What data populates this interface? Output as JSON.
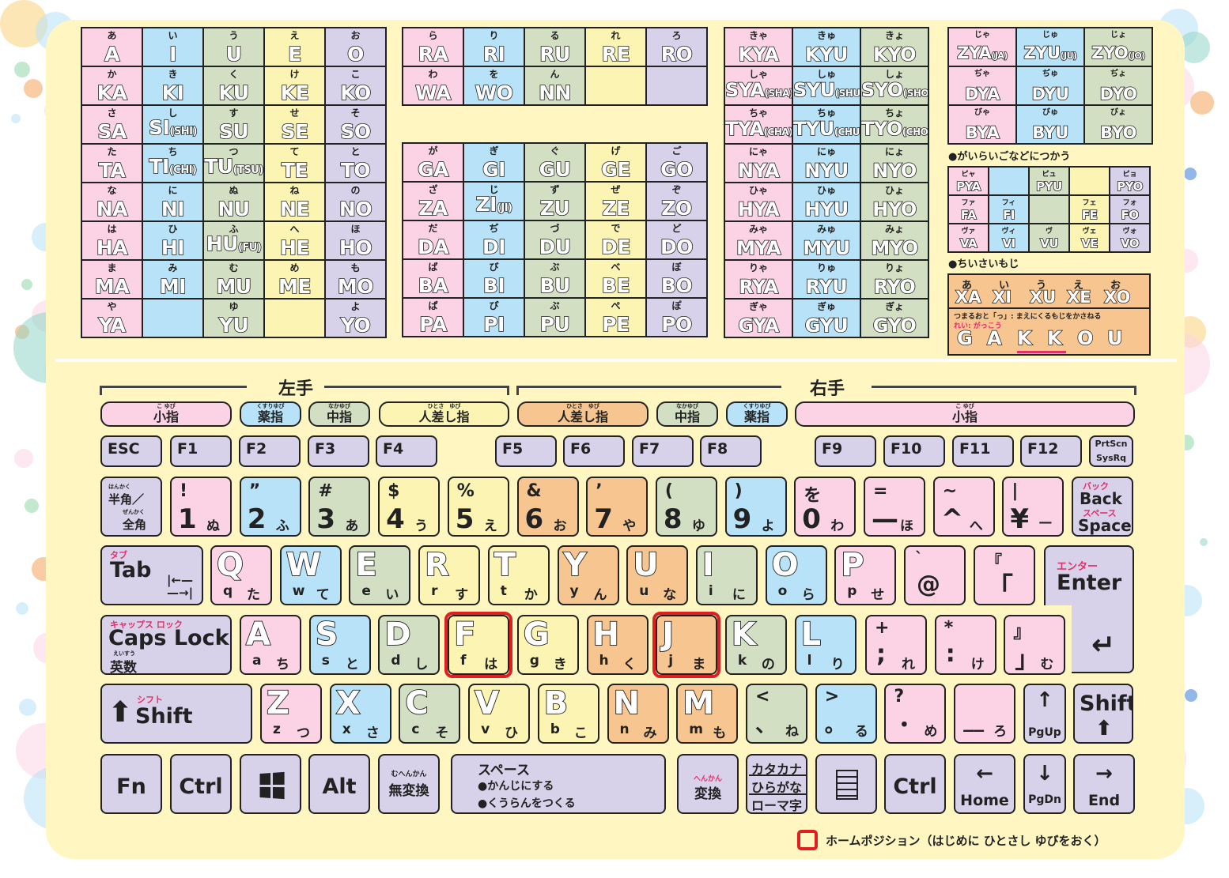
{
  "colors": {
    "pink": "#fbd3e4",
    "blue": "#b7e2f7",
    "green": "#d3dfc2",
    "yellow": "#fbf4b2",
    "purple": "#d7d1e9",
    "orange": "#f6c590",
    "home": "#e02020",
    "accent": "#e0306a"
  },
  "romaji_table_1": [
    [
      {
        "kana": "あ",
        "romaji": "A",
        "color": "pink"
      },
      {
        "kana": "い",
        "romaji": "I",
        "color": "blue"
      },
      {
        "kana": "う",
        "romaji": "U",
        "color": "green"
      },
      {
        "kana": "え",
        "romaji": "E",
        "color": "yellow"
      },
      {
        "kana": "お",
        "romaji": "O",
        "color": "purple"
      }
    ],
    [
      {
        "kana": "か",
        "romaji": "KA",
        "color": "pink"
      },
      {
        "kana": "き",
        "romaji": "KI",
        "color": "blue"
      },
      {
        "kana": "く",
        "romaji": "KU",
        "color": "green"
      },
      {
        "kana": "け",
        "romaji": "KE",
        "color": "yellow"
      },
      {
        "kana": "こ",
        "romaji": "KO",
        "color": "purple"
      }
    ],
    [
      {
        "kana": "さ",
        "romaji": "SA",
        "color": "pink"
      },
      {
        "kana": "し",
        "romaji": "SI",
        "alt": "(SHI)",
        "color": "blue"
      },
      {
        "kana": "す",
        "romaji": "SU",
        "color": "green"
      },
      {
        "kana": "せ",
        "romaji": "SE",
        "color": "yellow"
      },
      {
        "kana": "そ",
        "romaji": "SO",
        "color": "purple"
      }
    ],
    [
      {
        "kana": "た",
        "romaji": "TA",
        "color": "pink"
      },
      {
        "kana": "ち",
        "romaji": "TI",
        "alt": "(CHI)",
        "color": "blue"
      },
      {
        "kana": "つ",
        "romaji": "TU",
        "alt": "(TSU)",
        "color": "green"
      },
      {
        "kana": "て",
        "romaji": "TE",
        "color": "yellow"
      },
      {
        "kana": "と",
        "romaji": "TO",
        "color": "purple"
      }
    ],
    [
      {
        "kana": "な",
        "romaji": "NA",
        "color": "pink"
      },
      {
        "kana": "に",
        "romaji": "NI",
        "color": "blue"
      },
      {
        "kana": "ぬ",
        "romaji": "NU",
        "color": "green"
      },
      {
        "kana": "ね",
        "romaji": "NE",
        "color": "yellow"
      },
      {
        "kana": "の",
        "romaji": "NO",
        "color": "purple"
      }
    ],
    [
      {
        "kana": "は",
        "romaji": "HA",
        "color": "pink"
      },
      {
        "kana": "ひ",
        "romaji": "HI",
        "color": "blue"
      },
      {
        "kana": "ふ",
        "romaji": "HU",
        "alt": "(FU)",
        "color": "green"
      },
      {
        "kana": "へ",
        "romaji": "HE",
        "color": "yellow"
      },
      {
        "kana": "ほ",
        "romaji": "HO",
        "color": "purple"
      }
    ],
    [
      {
        "kana": "ま",
        "romaji": "MA",
        "color": "pink"
      },
      {
        "kana": "み",
        "romaji": "MI",
        "color": "blue"
      },
      {
        "kana": "む",
        "romaji": "MU",
        "color": "green"
      },
      {
        "kana": "め",
        "romaji": "ME",
        "color": "yellow"
      },
      {
        "kana": "も",
        "romaji": "MO",
        "color": "purple"
      }
    ],
    [
      {
        "kana": "や",
        "romaji": "YA",
        "color": "pink"
      },
      {
        "kana": "",
        "romaji": "",
        "color": "blue"
      },
      {
        "kana": "ゆ",
        "romaji": "YU",
        "color": "green"
      },
      {
        "kana": "",
        "romaji": "",
        "color": "yellow"
      },
      {
        "kana": "よ",
        "romaji": "YO",
        "color": "purple"
      }
    ]
  ],
  "romaji_table_2": [
    [
      {
        "kana": "ら",
        "romaji": "RA",
        "color": "pink"
      },
      {
        "kana": "り",
        "romaji": "RI",
        "color": "blue"
      },
      {
        "kana": "る",
        "romaji": "RU",
        "color": "green"
      },
      {
        "kana": "れ",
        "romaji": "RE",
        "color": "yellow"
      },
      {
        "kana": "ろ",
        "romaji": "RO",
        "color": "purple"
      }
    ],
    [
      {
        "kana": "わ",
        "romaji": "WA",
        "color": "pink"
      },
      {
        "kana": "を",
        "romaji": "WO",
        "color": "blue"
      },
      {
        "kana": "ん",
        "romaji": "NN",
        "color": "green"
      },
      {
        "kana": "",
        "romaji": "",
        "color": "yellow"
      },
      {
        "kana": "",
        "romaji": "",
        "color": "purple"
      }
    ]
  ],
  "romaji_table_3": [
    [
      {
        "kana": "が",
        "romaji": "GA",
        "color": "pink"
      },
      {
        "kana": "ぎ",
        "romaji": "GI",
        "color": "blue"
      },
      {
        "kana": "ぐ",
        "romaji": "GU",
        "color": "green"
      },
      {
        "kana": "げ",
        "romaji": "GE",
        "color": "yellow"
      },
      {
        "kana": "ご",
        "romaji": "GO",
        "color": "purple"
      }
    ],
    [
      {
        "kana": "ざ",
        "romaji": "ZA",
        "color": "pink"
      },
      {
        "kana": "じ",
        "romaji": "ZI",
        "alt": "(JI)",
        "color": "blue"
      },
      {
        "kana": "ず",
        "romaji": "ZU",
        "color": "green"
      },
      {
        "kana": "ぜ",
        "romaji": "ZE",
        "color": "yellow"
      },
      {
        "kana": "ぞ",
        "romaji": "ZO",
        "color": "purple"
      }
    ],
    [
      {
        "kana": "だ",
        "romaji": "DA",
        "color": "pink"
      },
      {
        "kana": "ぢ",
        "romaji": "DI",
        "color": "blue"
      },
      {
        "kana": "づ",
        "romaji": "DU",
        "color": "green"
      },
      {
        "kana": "で",
        "romaji": "DE",
        "color": "yellow"
      },
      {
        "kana": "ど",
        "romaji": "DO",
        "color": "purple"
      }
    ],
    [
      {
        "kana": "ば",
        "romaji": "BA",
        "color": "pink"
      },
      {
        "kana": "び",
        "romaji": "BI",
        "color": "blue"
      },
      {
        "kana": "ぶ",
        "romaji": "BU",
        "color": "green"
      },
      {
        "kana": "べ",
        "romaji": "BE",
        "color": "yellow"
      },
      {
        "kana": "ぼ",
        "romaji": "BO",
        "color": "purple"
      }
    ],
    [
      {
        "kana": "ぱ",
        "romaji": "PA",
        "color": "pink"
      },
      {
        "kana": "ぴ",
        "romaji": "PI",
        "color": "blue"
      },
      {
        "kana": "ぷ",
        "romaji": "PU",
        "color": "green"
      },
      {
        "kana": "ぺ",
        "romaji": "PE",
        "color": "yellow"
      },
      {
        "kana": "ぽ",
        "romaji": "PO",
        "color": "purple"
      }
    ]
  ],
  "romaji_table_4": [
    [
      {
        "kana": "きゃ",
        "romaji": "KYA",
        "color": "pink"
      },
      {
        "kana": "きゅ",
        "romaji": "KYU",
        "color": "blue"
      },
      {
        "kana": "きょ",
        "romaji": "KYO",
        "color": "green"
      }
    ],
    [
      {
        "kana": "しゃ",
        "romaji": "SYA",
        "alt": "(SHA)",
        "color": "pink"
      },
      {
        "kana": "しゅ",
        "romaji": "SYU",
        "alt": "(SHU)",
        "color": "blue"
      },
      {
        "kana": "しょ",
        "romaji": "SYO",
        "alt": "(SHO)",
        "color": "green"
      }
    ],
    [
      {
        "kana": "ちゃ",
        "romaji": "TYA",
        "alt": "(CHA)",
        "color": "pink"
      },
      {
        "kana": "ちゅ",
        "romaji": "TYU",
        "alt": "(CHU)",
        "color": "blue"
      },
      {
        "kana": "ちょ",
        "romaji": "TYO",
        "alt": "(CHO)",
        "color": "green"
      }
    ],
    [
      {
        "kana": "にゃ",
        "romaji": "NYA",
        "color": "pink"
      },
      {
        "kana": "にゅ",
        "romaji": "NYU",
        "color": "blue"
      },
      {
        "kana": "にょ",
        "romaji": "NYO",
        "color": "green"
      }
    ],
    [
      {
        "kana": "ひゃ",
        "romaji": "HYA",
        "color": "pink"
      },
      {
        "kana": "ひゅ",
        "romaji": "HYU",
        "color": "blue"
      },
      {
        "kana": "ひょ",
        "romaji": "HYO",
        "color": "green"
      }
    ],
    [
      {
        "kana": "みゃ",
        "romaji": "MYA",
        "color": "pink"
      },
      {
        "kana": "みゅ",
        "romaji": "MYU",
        "color": "blue"
      },
      {
        "kana": "みょ",
        "romaji": "MYO",
        "color": "green"
      }
    ],
    [
      {
        "kana": "りゃ",
        "romaji": "RYA",
        "color": "pink"
      },
      {
        "kana": "りゅ",
        "romaji": "RYU",
        "color": "blue"
      },
      {
        "kana": "りょ",
        "romaji": "RYO",
        "color": "green"
      }
    ],
    [
      {
        "kana": "ぎゃ",
        "romaji": "GYA",
        "color": "pink"
      },
      {
        "kana": "ぎゅ",
        "romaji": "GYU",
        "color": "blue"
      },
      {
        "kana": "ぎょ",
        "romaji": "GYO",
        "color": "green"
      }
    ]
  ],
  "romaji_table_5": [
    [
      {
        "kana": "じゃ",
        "romaji": "ZYA",
        "alt": "(JA)",
        "color": "pink"
      },
      {
        "kana": "じゅ",
        "romaji": "ZYU",
        "alt": "(JU)",
        "color": "blue"
      },
      {
        "kana": "じょ",
        "romaji": "ZYO",
        "alt": "(JO)",
        "color": "green"
      }
    ],
    [
      {
        "kana": "ぢゃ",
        "romaji": "DYA",
        "color": "pink"
      },
      {
        "kana": "ぢゅ",
        "romaji": "DYU",
        "color": "blue"
      },
      {
        "kana": "ぢょ",
        "romaji": "DYO",
        "color": "green"
      }
    ],
    [
      {
        "kana": "びゃ",
        "romaji": "BYA",
        "color": "pink"
      },
      {
        "kana": "びゅ",
        "romaji": "BYU",
        "color": "blue"
      },
      {
        "kana": "びょ",
        "romaji": "BYO",
        "color": "green"
      }
    ]
  ],
  "foreign_title": "●がいらいごなどにつかう",
  "foreign_table": [
    [
      {
        "kana": "ピャ",
        "romaji": "PYA",
        "color": "pink"
      },
      {
        "kana": "",
        "romaji": "",
        "color": "blue"
      },
      {
        "kana": "ピュ",
        "romaji": "PYU",
        "color": "green"
      },
      {
        "kana": "",
        "romaji": "",
        "color": "yellow"
      },
      {
        "kana": "ピョ",
        "romaji": "PYO",
        "color": "purple"
      }
    ],
    [
      {
        "kana": "ファ",
        "romaji": "FA",
        "color": "pink"
      },
      {
        "kana": "フィ",
        "romaji": "FI",
        "color": "blue"
      },
      {
        "kana": "",
        "romaji": "",
        "color": "green"
      },
      {
        "kana": "フェ",
        "romaji": "FE",
        "color": "yellow"
      },
      {
        "kana": "フォ",
        "romaji": "FO",
        "color": "purple"
      }
    ],
    [
      {
        "kana": "ヴァ",
        "romaji": "VA",
        "color": "pink"
      },
      {
        "kana": "ヴィ",
        "romaji": "VI",
        "color": "blue"
      },
      {
        "kana": "ヴ",
        "romaji": "VU",
        "color": "green"
      },
      {
        "kana": "ヴェ",
        "romaji": "VE",
        "color": "yellow"
      },
      {
        "kana": "ヴォ",
        "romaji": "VO",
        "color": "purple"
      }
    ]
  ],
  "small_title": "●ちいさいもじ",
  "small": {
    "kana": [
      "あ",
      "い",
      "う",
      "え",
      "お"
    ],
    "romaji": [
      "XA",
      "XI",
      "XU",
      "XE",
      "XO"
    ],
    "note": "つまるおと「っ」: まえにくるもじをかさねる",
    "example_label": "れい: がっこう",
    "example": [
      "G",
      "A",
      "K",
      "K",
      "O",
      "U"
    ]
  },
  "hands": {
    "left": "左手",
    "right": "右手"
  },
  "fingers": [
    {
      "ruby": "こ ゆび",
      "label": "小指",
      "color": "pink"
    },
    {
      "ruby": "くすりゆび",
      "label": "薬指",
      "color": "blue"
    },
    {
      "ruby": "なかゆび",
      "label": "中指",
      "color": "green"
    },
    {
      "ruby": "ひとさ　ゆび",
      "label": "人差し指",
      "color": "yellow"
    },
    {
      "ruby": "ひとさ　ゆび",
      "label": "人差し指",
      "color": "orange"
    },
    {
      "ruby": "なかゆび",
      "label": "中指",
      "color": "green"
    },
    {
      "ruby": "くすりゆび",
      "label": "薬指",
      "color": "blue"
    },
    {
      "ruby": "こ ゆび",
      "label": "小指",
      "color": "pink"
    }
  ],
  "fkeys": [
    "ESC",
    "F1",
    "F2",
    "F3",
    "F4",
    "F5",
    "F6",
    "F7",
    "F8",
    "F9",
    "F10",
    "F11",
    "F12"
  ],
  "prtscn": [
    "PrtScn",
    "SysRq"
  ],
  "hankaku": {
    "ruby1": "はんかく",
    "l1": "半角／",
    "ruby2": "ぜんかく",
    "l2": "全角"
  },
  "num_row": [
    {
      "up": "!",
      "main": "1",
      "kana": "ぬ",
      "color": "pink"
    },
    {
      "up": "”",
      "main": "2",
      "kana": "ふ",
      "color": "blue"
    },
    {
      "up": "#",
      "main": "3",
      "kana": "あ",
      "color": "green"
    },
    {
      "up": "$",
      "main": "4",
      "kana": "う",
      "color": "yellow"
    },
    {
      "up": "%",
      "main": "5",
      "kana": "え",
      "color": "yellow"
    },
    {
      "up": "&",
      "main": "6",
      "kana": "お",
      "color": "orange"
    },
    {
      "up": "’",
      "main": "7",
      "kana": "や",
      "color": "orange"
    },
    {
      "up": "(",
      "main": "8",
      "kana": "ゆ",
      "color": "green"
    },
    {
      "up": ")",
      "main": "9",
      "kana": "よ",
      "color": "blue"
    },
    {
      "up": "を",
      "main": "0",
      "kana": "わ",
      "color": "pink"
    },
    {
      "up": "=",
      "main": "—",
      "kana": "ほ",
      "color": "pink"
    },
    {
      "up": "~",
      "main": "^",
      "kana": "へ",
      "color": "pink"
    },
    {
      "up": "|",
      "main": "¥",
      "kana": "—",
      "color": "pink"
    }
  ],
  "backspace": {
    "ruby1": "バック",
    "l1": "Back",
    "ruby2": "スペース",
    "l2": "Space"
  },
  "tab": {
    "ruby": "タブ",
    "label": "Tab"
  },
  "q_row": [
    {
      "main": "Q",
      "low": "q",
      "kana": "た",
      "color": "pink"
    },
    {
      "main": "W",
      "low": "w",
      "kana": "て",
      "color": "blue"
    },
    {
      "main": "E",
      "low": "e",
      "kana": "い",
      "color": "green"
    },
    {
      "main": "R",
      "low": "r",
      "kana": "す",
      "color": "yellow"
    },
    {
      "main": "T",
      "low": "t",
      "kana": "か",
      "color": "yellow"
    },
    {
      "main": "Y",
      "low": "y",
      "kana": "ん",
      "color": "orange"
    },
    {
      "main": "U",
      "low": "u",
      "kana": "な",
      "color": "orange"
    },
    {
      "main": "I",
      "low": "i",
      "kana": "に",
      "color": "green"
    },
    {
      "main": "O",
      "low": "o",
      "kana": "ら",
      "color": "blue"
    },
    {
      "main": "P",
      "low": "p",
      "kana": "せ",
      "color": "pink"
    }
  ],
  "at_key": {
    "up": "`",
    "main": "@"
  },
  "bracket_key": {
    "up": "『",
    "main": "「"
  },
  "enter": {
    "ruby": "エンター",
    "label": "Enter",
    "arrow": "↵"
  },
  "caps": {
    "ruby": "キャップス ロック",
    "label": "Caps Lock",
    "ruby2": "えいすう",
    "label2": "英数"
  },
  "a_row": [
    {
      "main": "A",
      "low": "a",
      "kana": "ち",
      "color": "pink"
    },
    {
      "main": "S",
      "low": "s",
      "kana": "と",
      "color": "blue"
    },
    {
      "main": "D",
      "low": "d",
      "kana": "し",
      "color": "green"
    },
    {
      "main": "F",
      "low": "f",
      "kana": "は",
      "color": "yellow"
    },
    {
      "main": "G",
      "low": "g",
      "kana": "き",
      "color": "yellow"
    },
    {
      "main": "H",
      "low": "h",
      "kana": "く",
      "color": "orange"
    },
    {
      "main": "J",
      "low": "j",
      "kana": "ま",
      "color": "orange"
    },
    {
      "main": "K",
      "low": "k",
      "kana": "の",
      "color": "green"
    },
    {
      "main": "L",
      "low": "l",
      "kana": "り",
      "color": "blue"
    }
  ],
  "a_row_sym": [
    {
      "up": "+",
      "main": ";",
      "kana": "れ"
    },
    {
      "up": "*",
      "main": ":",
      "kana": "け"
    },
    {
      "up": "』",
      "main": "」",
      "kana": "む"
    }
  ],
  "shift_left": {
    "ruby": "シフト",
    "label": "Shift"
  },
  "z_row": [
    {
      "main": "Z",
      "low": "z",
      "kana": "つ",
      "color": "pink"
    },
    {
      "main": "X",
      "low": "x",
      "kana": "さ",
      "color": "blue"
    },
    {
      "main": "C",
      "low": "c",
      "kana": "そ",
      "color": "green"
    },
    {
      "main": "V",
      "low": "v",
      "kana": "ひ",
      "color": "yellow"
    },
    {
      "main": "B",
      "low": "b",
      "kana": "こ",
      "color": "yellow"
    },
    {
      "main": "N",
      "low": "n",
      "kana": "み",
      "color": "orange"
    },
    {
      "main": "M",
      "low": "m",
      "kana": "も",
      "color": "orange"
    }
  ],
  "z_row_sym": [
    {
      "up": "<",
      "main": "、",
      "kana": "ね",
      "color": "green"
    },
    {
      "up": ">",
      "main": "。",
      "kana": "る",
      "color": "blue"
    },
    {
      "up": "?",
      "main": "・",
      "kana": "め",
      "color": "pink"
    },
    {
      "up": "",
      "main": "__",
      "kana": "ろ",
      "color": "pink"
    }
  ],
  "pgup": {
    "arrow": "↑",
    "label": "PgUp"
  },
  "shift_right": {
    "label": "Shift"
  },
  "bottom": {
    "fn": "Fn",
    "ctrl": "Ctrl",
    "alt": "Alt",
    "muhenkan_ruby": "むへんかん",
    "muhenkan": "無変換",
    "space_title": "スペース",
    "space_1": "●かんじにする",
    "space_2": "●くうらんをつくる",
    "henkan_ruby": "へんかん",
    "henkan": "変換",
    "kana_1": "カタカナ",
    "kana_2": "ひらがな",
    "kana_3": "ローマ字",
    "ctrl2": "Ctrl",
    "home": "Home",
    "pgdn": "PgDn",
    "end": "End",
    "home_arrow": "←",
    "pgdn_arrow": "↓",
    "end_arrow": "→"
  },
  "legend": "ホームポジション（はじめに ひとさし ゆびをおく）"
}
